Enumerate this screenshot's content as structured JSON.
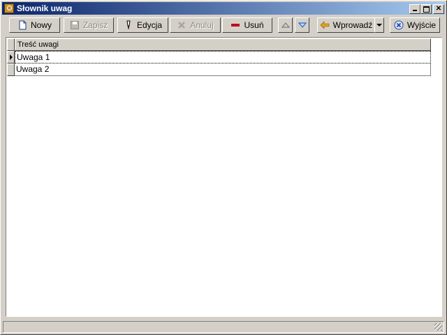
{
  "window": {
    "title": "Słownik uwag"
  },
  "toolbar": {
    "new": {
      "label": "Nowy",
      "icon": "new-document-icon"
    },
    "save": {
      "label": "Zapisz",
      "icon": "save-icon"
    },
    "edit": {
      "label": "Edycja",
      "icon": "edit-pen-icon"
    },
    "cancel": {
      "label": "Anuluj",
      "icon": "cancel-x-icon"
    },
    "delete": {
      "label": "Usuń",
      "icon": "minus-icon"
    },
    "up": {
      "icon": "arrow-up-icon"
    },
    "down": {
      "icon": "arrow-down-icon"
    },
    "enter": {
      "label": "Wprowadź",
      "icon": "arrow-left-icon"
    },
    "exit": {
      "label": "Wyjście",
      "icon": "exit-icon"
    }
  },
  "grid": {
    "column_header": "Treść uwagi",
    "rows": [
      {
        "text": "Uwaga 1",
        "selected": true
      },
      {
        "text": "Uwaga 2",
        "selected": false
      }
    ]
  },
  "colors": {
    "titlebar_start": "#0a246a",
    "titlebar_end": "#a6caf0",
    "face": "#d4d0c8"
  }
}
